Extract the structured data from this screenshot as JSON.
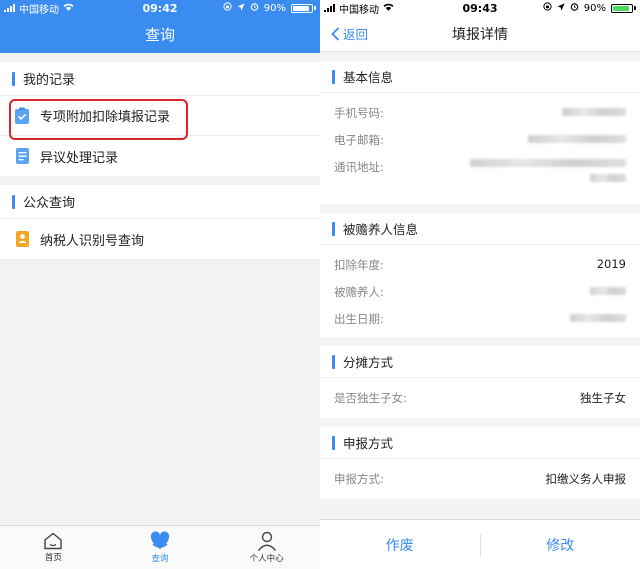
{
  "status_left": {
    "carrier": "中国移动",
    "time": "09:42",
    "battery": "90%"
  },
  "status_right": {
    "carrier": "中国移动",
    "time": "09:43",
    "battery": "90%"
  },
  "left": {
    "title": "查询",
    "section1": {
      "label": "我的记录",
      "items": [
        "专项附加扣除填报记录",
        "异议处理记录"
      ]
    },
    "section2": {
      "label": "公众查询",
      "items": [
        "纳税人识别号查询"
      ]
    },
    "tabs": [
      "首页",
      "查询",
      "个人中心"
    ]
  },
  "right": {
    "back": "返回",
    "title": "填报详情",
    "basic": {
      "label": "基本信息",
      "phone_label": "手机号码:",
      "email_label": "电子邮箱:",
      "address_label": "通讯地址:"
    },
    "dependent": {
      "label": "被赡养人信息",
      "year_label": "扣除年度:",
      "year_value": "2019",
      "name_label": "被赡养人:",
      "birth_label": "出生日期:"
    },
    "share": {
      "label": "分摊方式",
      "only_child_label": "是否独生子女:",
      "only_child_value": "独生子女"
    },
    "declare": {
      "label": "申报方式",
      "method_label": "申报方式:",
      "method_value": "扣缴义务人申报"
    },
    "void_button": "作废",
    "edit_button": "修改"
  },
  "colors": {
    "accent": "#3b8cf0",
    "highlight": "#d9262c"
  }
}
